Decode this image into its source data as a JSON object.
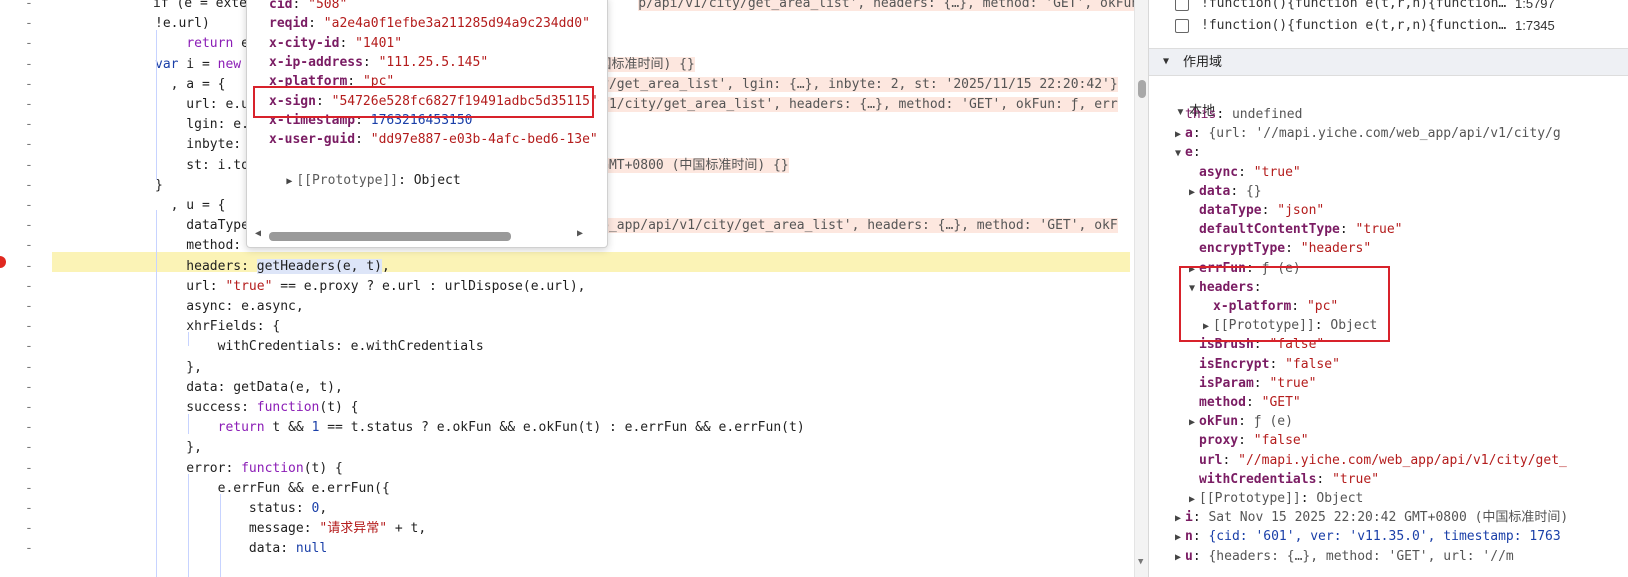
{
  "editor": {
    "lines": [
      [
        {
          "t": "if (e = exte"
        },
        {
          "t": "                                                  "
        },
        {
          "t": "p/api/v1/city/get_area_list', headers: {…}, method: 'GET', okFun:",
          "c": "pill"
        }
      ],
      [
        {
          "t": "!e.url)"
        }
      ],
      [
        {
          "t": "    "
        },
        {
          "t": "return",
          "c": "kw"
        },
        {
          "t": " e"
        }
      ],
      [
        {
          "t": "var",
          "c": "kw2"
        },
        {
          "t": " i = "
        },
        {
          "t": "new",
          "c": "kw"
        },
        {
          "t": "                                           "
        },
        {
          "t": "(中国标准时间) {}",
          "c": "pill"
        }
      ],
      [
        {
          "t": "  , a = {  "
        },
        {
          "t": "                                              "
        },
        {
          "t": "y/get_area_list', lgin: {…}, inbyte: 2, st: '2025/11/15 22:20:42'}",
          "c": "pill"
        }
      ],
      [
        {
          "t": "    url: e.u"
        },
        {
          "t": "                                            "
        },
        {
          "t": "/v1/city/get_area_list', headers: {…}, method: 'GET', okFun: ƒ, err",
          "c": "pill"
        }
      ],
      [
        {
          "t": "    lgin: e."
        }
      ],
      [
        {
          "t": "    inbyte: "
        }
      ],
      [
        {
          "t": "    st: i.to"
        },
        {
          "t": "                                            "
        },
        {
          "t": " GMT+0800 (中国标准时间) {}",
          "c": "pill"
        }
      ],
      [
        {
          "t": "}"
        }
      ],
      [
        {
          "t": "  , u = {  "
        }
      ],
      [
        {
          "t": "    dataType"
        },
        {
          "t": "                                            "
        },
        {
          "t": "eb_app/api/v1/city/get_area_list', headers: {…}, method: 'GET', okF",
          "c": "pill"
        }
      ],
      [
        {
          "t": "    method: "
        }
      ],
      [
        {
          "t": "    headers: "
        },
        {
          "t": "getHeaders(e, t)",
          "c": "sel"
        },
        {
          "t": ","
        }
      ],
      [
        {
          "t": "    url: "
        },
        {
          "t": "\"true\"",
          "c": "str"
        },
        {
          "t": " == e.proxy ? e.url : urlDispose(e.url),"
        }
      ],
      [
        {
          "t": "    async: e.async,"
        }
      ],
      [
        {
          "t": "    xhrFields: {"
        }
      ],
      [
        {
          "t": "        withCredentials: e.withCredentials"
        }
      ],
      [
        {
          "t": "    },"
        }
      ],
      [
        {
          "t": "    data: getData(e, t),"
        }
      ],
      [
        {
          "t": "    success: "
        },
        {
          "t": "function",
          "c": "kw"
        },
        {
          "t": "(t) {"
        }
      ],
      [
        {
          "t": "        "
        },
        {
          "t": "return",
          "c": "kw"
        },
        {
          "t": " t && "
        },
        {
          "t": "1",
          "c": "num"
        },
        {
          "t": " == t.status ? e.okFun && e.okFun(t) : e.errFun && e.errFun(t)"
        }
      ],
      [
        {
          "t": "    },"
        }
      ],
      [
        {
          "t": "    error: "
        },
        {
          "t": "function",
          "c": "kw"
        },
        {
          "t": "(t) {"
        }
      ],
      [
        {
          "t": "        e.errFun && e.errFun({"
        }
      ],
      [
        {
          "t": "            status: "
        },
        {
          "t": "0",
          "c": "num"
        },
        {
          "t": ","
        }
      ],
      [
        {
          "t": "            message: "
        },
        {
          "t": "\"请求异常\"",
          "c": "str"
        },
        {
          "t": " + t,"
        }
      ],
      [
        {
          "t": "            data: "
        },
        {
          "t": "null",
          "c": "kw2"
        }
      ]
    ]
  },
  "tooltip": {
    "props": [
      {
        "key": "cid",
        "value": "\"508\"",
        "vc": "pv"
      },
      {
        "key": "reqid",
        "value": "\"a2e4a0f1efbe3a211285d94a9c234dd0\"",
        "vc": "pv"
      },
      {
        "key": "x-city-id",
        "value": "\"1401\"",
        "vc": "pv"
      },
      {
        "key": "x-ip-address",
        "value": "\"111.25.5.145\"",
        "vc": "pv"
      },
      {
        "key": "x-platform",
        "value": "\"pc\"",
        "vc": "pv"
      },
      {
        "key": "x-sign",
        "value": "\"54726e528fc6827f19491adbc5d35115\"",
        "vc": "pv"
      },
      {
        "key": "x-timestamp",
        "value": "1763216453150",
        "vc": "pn"
      },
      {
        "key": "x-user-guid",
        "value": "\"dd97e887-e03b-4afc-bed6-13e\"",
        "vc": "pv"
      }
    ],
    "prototype_label": "[[Prototype]]",
    "prototype_value": "Object"
  },
  "panel": {
    "callstack": [
      {
        "name": "!function(){function e(t,r,n){function…",
        "loc": "1:5797"
      },
      {
        "name": "!function(){function e(t,r,n){function…",
        "loc": "1:7345"
      }
    ],
    "scope_title": "作用域",
    "local_title": "本地",
    "scope": [
      {
        "indent": 0,
        "tri": "",
        "k": "this",
        "kc": "sk2",
        "v": "undefined",
        "vc": "sd"
      },
      {
        "indent": 0,
        "tri": "▶",
        "k": "a",
        "kc": "sk",
        "v": "{url: '//mapi.yiche.com/web_app/api/v1/city/g",
        "vc": "sd"
      },
      {
        "indent": 0,
        "tri": "▼",
        "k": "e",
        "kc": "sk",
        "v": "",
        "vc": "sd"
      },
      {
        "indent": 1,
        "tri": "",
        "k": "async",
        "kc": "sk",
        "v": "\"true\"",
        "vc": "sv"
      },
      {
        "indent": 1,
        "tri": "▶",
        "k": "data",
        "kc": "sk",
        "v": "{}",
        "vc": "sd"
      },
      {
        "indent": 1,
        "tri": "",
        "k": "dataType",
        "kc": "sk",
        "v": "\"json\"",
        "vc": "sv"
      },
      {
        "indent": 1,
        "tri": "",
        "k": "defaultContentType",
        "kc": "sk",
        "v": "\"true\"",
        "vc": "sv"
      },
      {
        "indent": 1,
        "tri": "",
        "k": "encryptType",
        "kc": "sk",
        "v": "\"headers\"",
        "vc": "sv"
      },
      {
        "indent": 1,
        "tri": "▶",
        "k": "errFun",
        "kc": "sk",
        "v": "ƒ (e)",
        "vc": "sd"
      },
      {
        "indent": 1,
        "tri": "▼",
        "k": "headers",
        "kc": "sk",
        "v": "",
        "vc": "sd"
      },
      {
        "indent": 2,
        "tri": "",
        "k": "x-platform",
        "kc": "sk",
        "v": "\"pc\"",
        "vc": "sv"
      },
      {
        "indent": 2,
        "tri": "▶",
        "k": "[[Prototype]]",
        "kc": "sd",
        "v": "Object",
        "vc": "sd"
      },
      {
        "indent": 1,
        "tri": "",
        "k": "isBrush",
        "kc": "sk",
        "v": "\"false\"",
        "vc": "sv"
      },
      {
        "indent": 1,
        "tri": "",
        "k": "isEncrypt",
        "kc": "sk",
        "v": "\"false\"",
        "vc": "sv"
      },
      {
        "indent": 1,
        "tri": "",
        "k": "isParam",
        "kc": "sk",
        "v": "\"true\"",
        "vc": "sv"
      },
      {
        "indent": 1,
        "tri": "",
        "k": "method",
        "kc": "sk",
        "v": "\"GET\"",
        "vc": "sv"
      },
      {
        "indent": 1,
        "tri": "▶",
        "k": "okFun",
        "kc": "sk",
        "v": "ƒ (e)",
        "vc": "sd"
      },
      {
        "indent": 1,
        "tri": "",
        "k": "proxy",
        "kc": "sk",
        "v": "\"false\"",
        "vc": "sv"
      },
      {
        "indent": 1,
        "tri": "",
        "k": "url",
        "kc": "sk",
        "v": "\"//mapi.yiche.com/web_app/api/v1/city/get_",
        "vc": "sv"
      },
      {
        "indent": 1,
        "tri": "",
        "k": "withCredentials",
        "kc": "sk",
        "v": "\"true\"",
        "vc": "sv"
      },
      {
        "indent": 1,
        "tri": "▶",
        "k": "[[Prototype]]",
        "kc": "sd",
        "v": "Object",
        "vc": "sd"
      },
      {
        "indent": 0,
        "tri": "▶",
        "k": "i",
        "kc": "sk",
        "v": "Sat Nov 15 2025 22:20:42 GMT+0800 (中国标准时间)",
        "vc": "sd"
      },
      {
        "indent": 0,
        "tri": "▶",
        "k": "n",
        "kc": "sk",
        "v": "{cid: '601', ver: 'v11.35.0', timestamp: 1763",
        "vc": "sn"
      },
      {
        "indent": 0,
        "tri": "▶",
        "k": "u",
        "kc": "sk",
        "v": "{headers: {…}, method: 'GET', url: '//m",
        "vc": "sd"
      }
    ]
  }
}
